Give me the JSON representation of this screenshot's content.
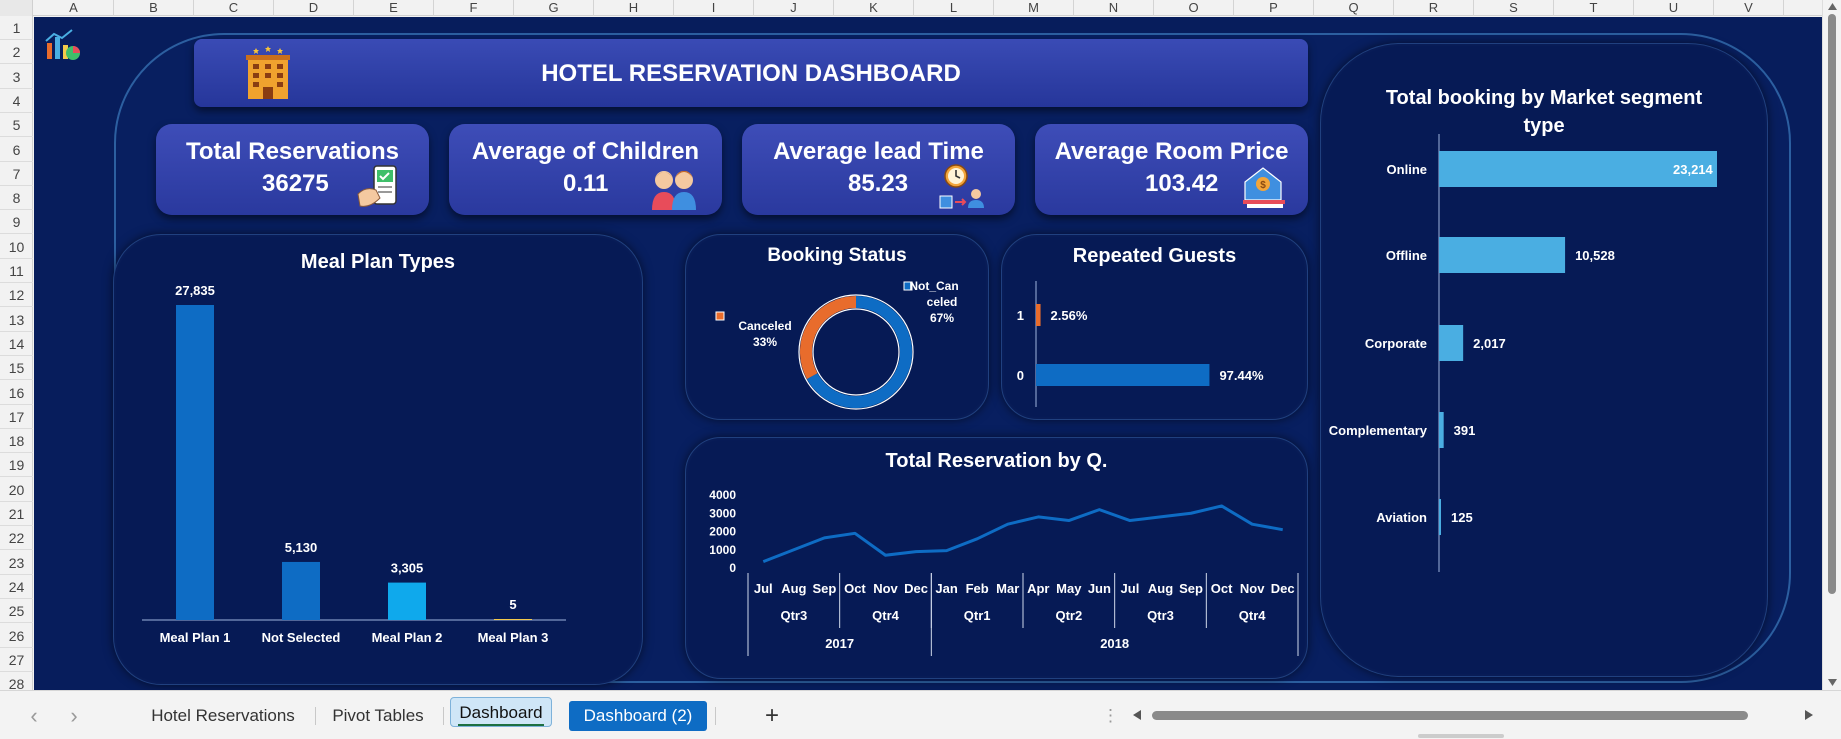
{
  "columns": [
    "A",
    "B",
    "C",
    "D",
    "E",
    "F",
    "G",
    "H",
    "I",
    "J",
    "K",
    "L",
    "M",
    "N",
    "O",
    "P",
    "Q",
    "R",
    "S",
    "T",
    "U",
    "V"
  ],
  "rows": [
    "1",
    "2",
    "3",
    "4",
    "5",
    "6",
    "7",
    "8",
    "9",
    "10",
    "11",
    "12",
    "13",
    "14",
    "15",
    "16",
    "17",
    "18",
    "19",
    "20",
    "21",
    "22",
    "23",
    "24",
    "25",
    "26",
    "27",
    "28"
  ],
  "dashboard": {
    "title": "HOTEL RESERVATION DASHBOARD",
    "kpis": [
      {
        "label": "Total Reservations",
        "value": "36275",
        "icon": "phone-booking-icon"
      },
      {
        "label": "Average of Children",
        "value": "0.11",
        "icon": "children-icon"
      },
      {
        "label": "Average lead Time",
        "value": "85.23",
        "icon": "clock-lead-time-icon"
      },
      {
        "label": "Average Room Price",
        "value": "103.42",
        "icon": "room-price-icon"
      }
    ]
  },
  "colors": {
    "sheet_bg": "#071d5c",
    "bar_blue": "#0e6cc4",
    "bar_light": "#0fa9ec",
    "market_bar": "#4aaee2",
    "orange": "#e86c2c",
    "kpi_bg": "#3241a8",
    "tab_active_bg": "#0e6cc4"
  },
  "chart_data": [
    {
      "type": "bar",
      "title": "Meal Plan Types",
      "categories": [
        "Meal Plan 1",
        "Not Selected",
        "Meal Plan 2",
        "Meal Plan 3"
      ],
      "values": [
        27835,
        5130,
        3305,
        5
      ],
      "value_labels": [
        "27,835",
        "5,130",
        "3,305",
        "5"
      ],
      "ylim": [
        0,
        27835
      ]
    },
    {
      "type": "pie",
      "title": "Booking Status",
      "slices": [
        {
          "name": "Not_Canceled",
          "label_lines": [
            "Not_Can",
            "celed",
            "67%"
          ],
          "value": 67
        },
        {
          "name": "Canceled",
          "label_lines": [
            "Canceled",
            "33%"
          ],
          "value": 33
        }
      ]
    },
    {
      "type": "bar",
      "title": "Repeated Guests",
      "categories": [
        "1",
        "0"
      ],
      "values": [
        2.56,
        97.44
      ],
      "value_labels": [
        "2.56%",
        "97.44%"
      ]
    },
    {
      "type": "line",
      "title": "Total Reservation by Q.",
      "y_ticks": [
        "4000",
        "3000",
        "2000",
        "1000",
        "0"
      ],
      "ylim": [
        0,
        4000
      ],
      "months": [
        "Jul",
        "Aug",
        "Sep",
        "Oct",
        "Nov",
        "Dec",
        "Jan",
        "Feb",
        "Mar",
        "Apr",
        "May",
        "Jun",
        "Jul",
        "Aug",
        "Sep",
        "Oct",
        "Nov",
        "Dec"
      ],
      "quarters": [
        {
          "label": "Qtr3",
          "span": 3
        },
        {
          "label": "Qtr4",
          "span": 3
        },
        {
          "label": "Qtr1",
          "span": 3
        },
        {
          "label": "Qtr2",
          "span": 3
        },
        {
          "label": "Qtr3",
          "span": 3
        },
        {
          "label": "Qtr4",
          "span": 3
        }
      ],
      "years": [
        {
          "label": "2017",
          "span": 6
        },
        {
          "label": "2018",
          "span": 12
        }
      ],
      "values": [
        350,
        1000,
        1650,
        1900,
        700,
        900,
        950,
        1600,
        2400,
        2800,
        2600,
        3200,
        2600,
        2800,
        3000,
        3400,
        2400,
        2100
      ]
    },
    {
      "type": "bar",
      "title": "Total booking by Market segment type",
      "title_lines": [
        "Total booking by Market segment",
        "type"
      ],
      "categories": [
        "Online",
        "Offline",
        "Corporate",
        "Complementary",
        "Aviation"
      ],
      "values": [
        23214,
        10528,
        2017,
        391,
        125
      ],
      "value_labels": [
        "23,214",
        "10,528",
        "2,017",
        "391",
        "125"
      ],
      "xlim": [
        0,
        23214
      ]
    }
  ],
  "tabs": [
    {
      "label": "Hotel Reservations"
    },
    {
      "label": "Pivot Tables"
    },
    {
      "label": "Dashboard"
    },
    {
      "label": "Dashboard  (2)"
    }
  ],
  "tab_nav": {
    "prev": "‹",
    "next": "›",
    "add": "+",
    "more": "⋮"
  }
}
